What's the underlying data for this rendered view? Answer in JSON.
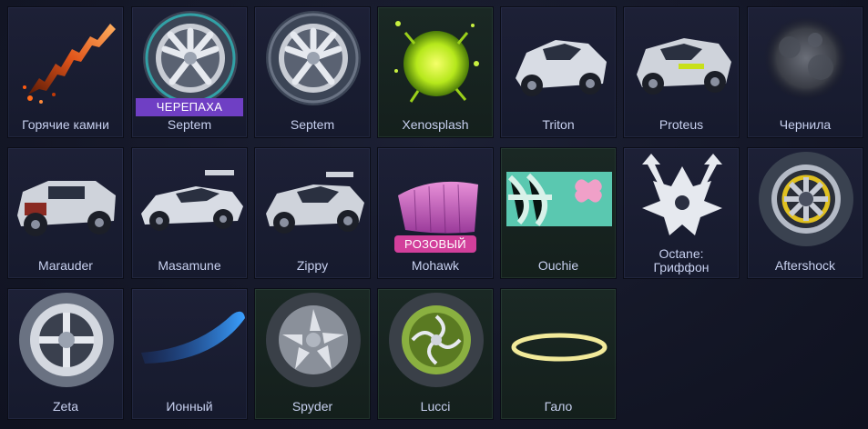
{
  "items": [
    {
      "name": "Горячие камни",
      "badge": "",
      "icon": "hot-rocks-trail-icon"
    },
    {
      "name": "Septem",
      "badge": "ЧЕРЕПАХА",
      "icon": "wheel-icon"
    },
    {
      "name": "Septem",
      "badge": "",
      "icon": "wheel-icon"
    },
    {
      "name": "Xenosplash",
      "badge": "",
      "icon": "goal-explosion-icon"
    },
    {
      "name": "Triton",
      "badge": "",
      "icon": "car-body-icon"
    },
    {
      "name": "Proteus",
      "badge": "",
      "icon": "car-body-icon"
    },
    {
      "name": "Чернила",
      "badge": "",
      "icon": "ink-boost-icon"
    },
    {
      "name": "Marauder",
      "badge": "",
      "icon": "car-body-icon"
    },
    {
      "name": "Masamune",
      "badge": "",
      "icon": "car-body-icon"
    },
    {
      "name": "Zippy",
      "badge": "",
      "icon": "car-body-icon"
    },
    {
      "name": "Mohawk",
      "badge": "РОЗОВЫЙ",
      "icon": "mohawk-topper-icon"
    },
    {
      "name": "Ouchie",
      "badge": "",
      "icon": "bandage-decal-icon"
    },
    {
      "name_line1": "Octane:",
      "name_line2": "Гриффон",
      "badge": "",
      "icon": "crest-decal-icon"
    },
    {
      "name": "Aftershock",
      "badge": "",
      "icon": "wheel-icon"
    },
    {
      "name": "Zeta",
      "badge": "",
      "icon": "wheel-icon"
    },
    {
      "name": "Ионный",
      "badge": "",
      "icon": "ion-trail-icon"
    },
    {
      "name": "Spyder",
      "badge": "",
      "icon": "wheel-icon"
    },
    {
      "name": "Lucci",
      "badge": "",
      "icon": "wheel-icon"
    },
    {
      "name": "Гало",
      "badge": "",
      "icon": "halo-topper-icon"
    }
  ]
}
